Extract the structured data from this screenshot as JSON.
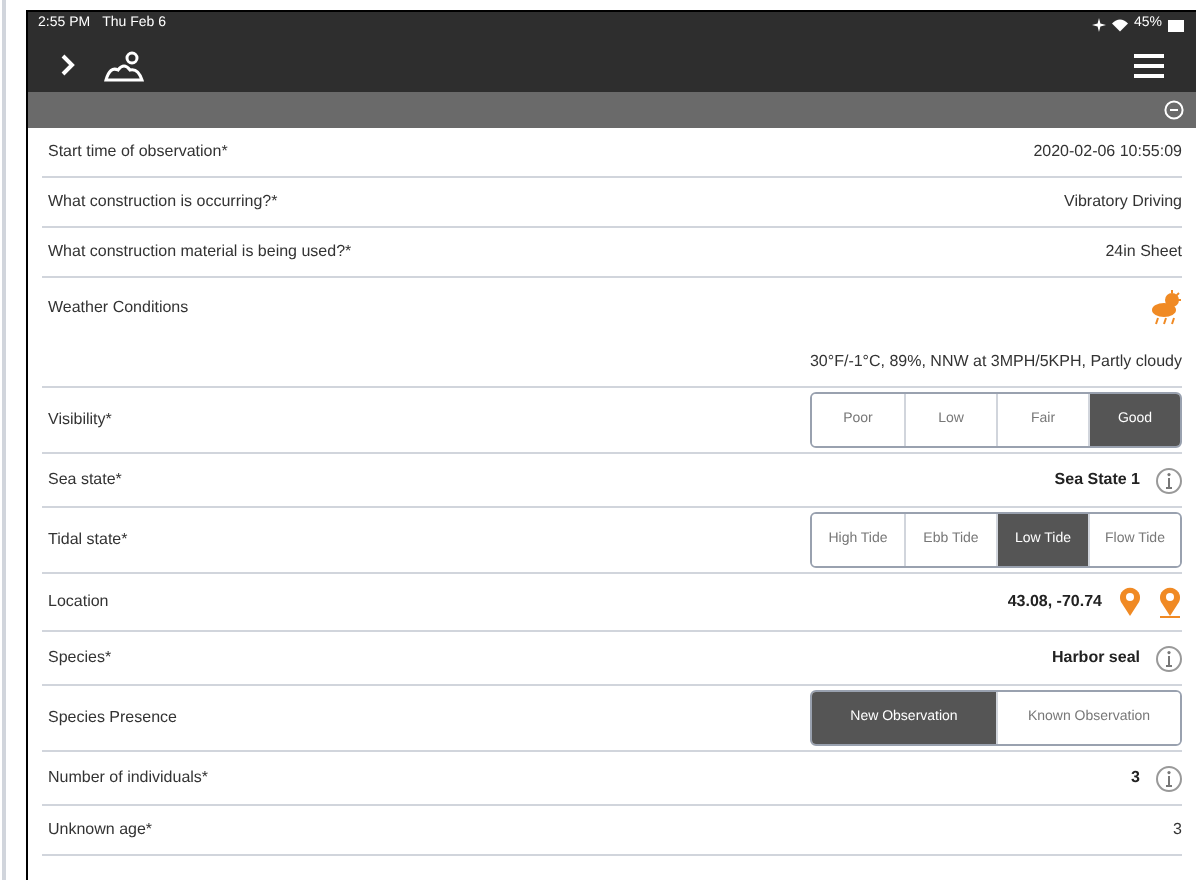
{
  "status_bar": {
    "time": "2:55 PM",
    "date": "Thu Feb 6",
    "battery": "45%"
  },
  "rows": [
    {
      "kind": "value",
      "label": "Start time of observation*",
      "value": "2020-02-06 10:55:09"
    },
    {
      "kind": "value",
      "label": "What construction is occurring?*",
      "value": "Vibratory Driving"
    },
    {
      "kind": "value",
      "label": "What construction  material is being used?*",
      "value": "24in Sheet"
    },
    {
      "kind": "weather",
      "label": "Weather Conditions",
      "value": "30°F/-1°C, 89%, NNW at 3MPH/5KPH, Partly cloudy"
    },
    {
      "kind": "segmented",
      "label": "Visibility*",
      "options": [
        {
          "label": "Poor",
          "selected": false
        },
        {
          "label": "Low",
          "selected": false
        },
        {
          "label": "Fair",
          "selected": false
        },
        {
          "label": "Good",
          "selected": true
        }
      ]
    },
    {
      "kind": "info",
      "label": "Sea state*",
      "value": "Sea State 1"
    },
    {
      "kind": "segmented",
      "label": "Tidal state*",
      "options": [
        {
          "label": "High Tide",
          "selected": false
        },
        {
          "label": "Ebb Tide",
          "selected": false
        },
        {
          "label": "Low Tide",
          "selected": true
        },
        {
          "label": "Flow Tide",
          "selected": false
        }
      ]
    },
    {
      "kind": "location",
      "label": "Location",
      "value": "43.08, -70.74"
    },
    {
      "kind": "info",
      "label": "Species*",
      "value": "Harbor seal"
    },
    {
      "kind": "segmented",
      "label": "Species Presence",
      "options": [
        {
          "label": "New Observation",
          "selected": true
        },
        {
          "label": "Known Observation",
          "selected": false
        }
      ]
    },
    {
      "kind": "info",
      "label": "Number of individuals*",
      "value": "3"
    },
    {
      "kind": "value",
      "label": "Unknown age*",
      "value": "3"
    }
  ]
}
